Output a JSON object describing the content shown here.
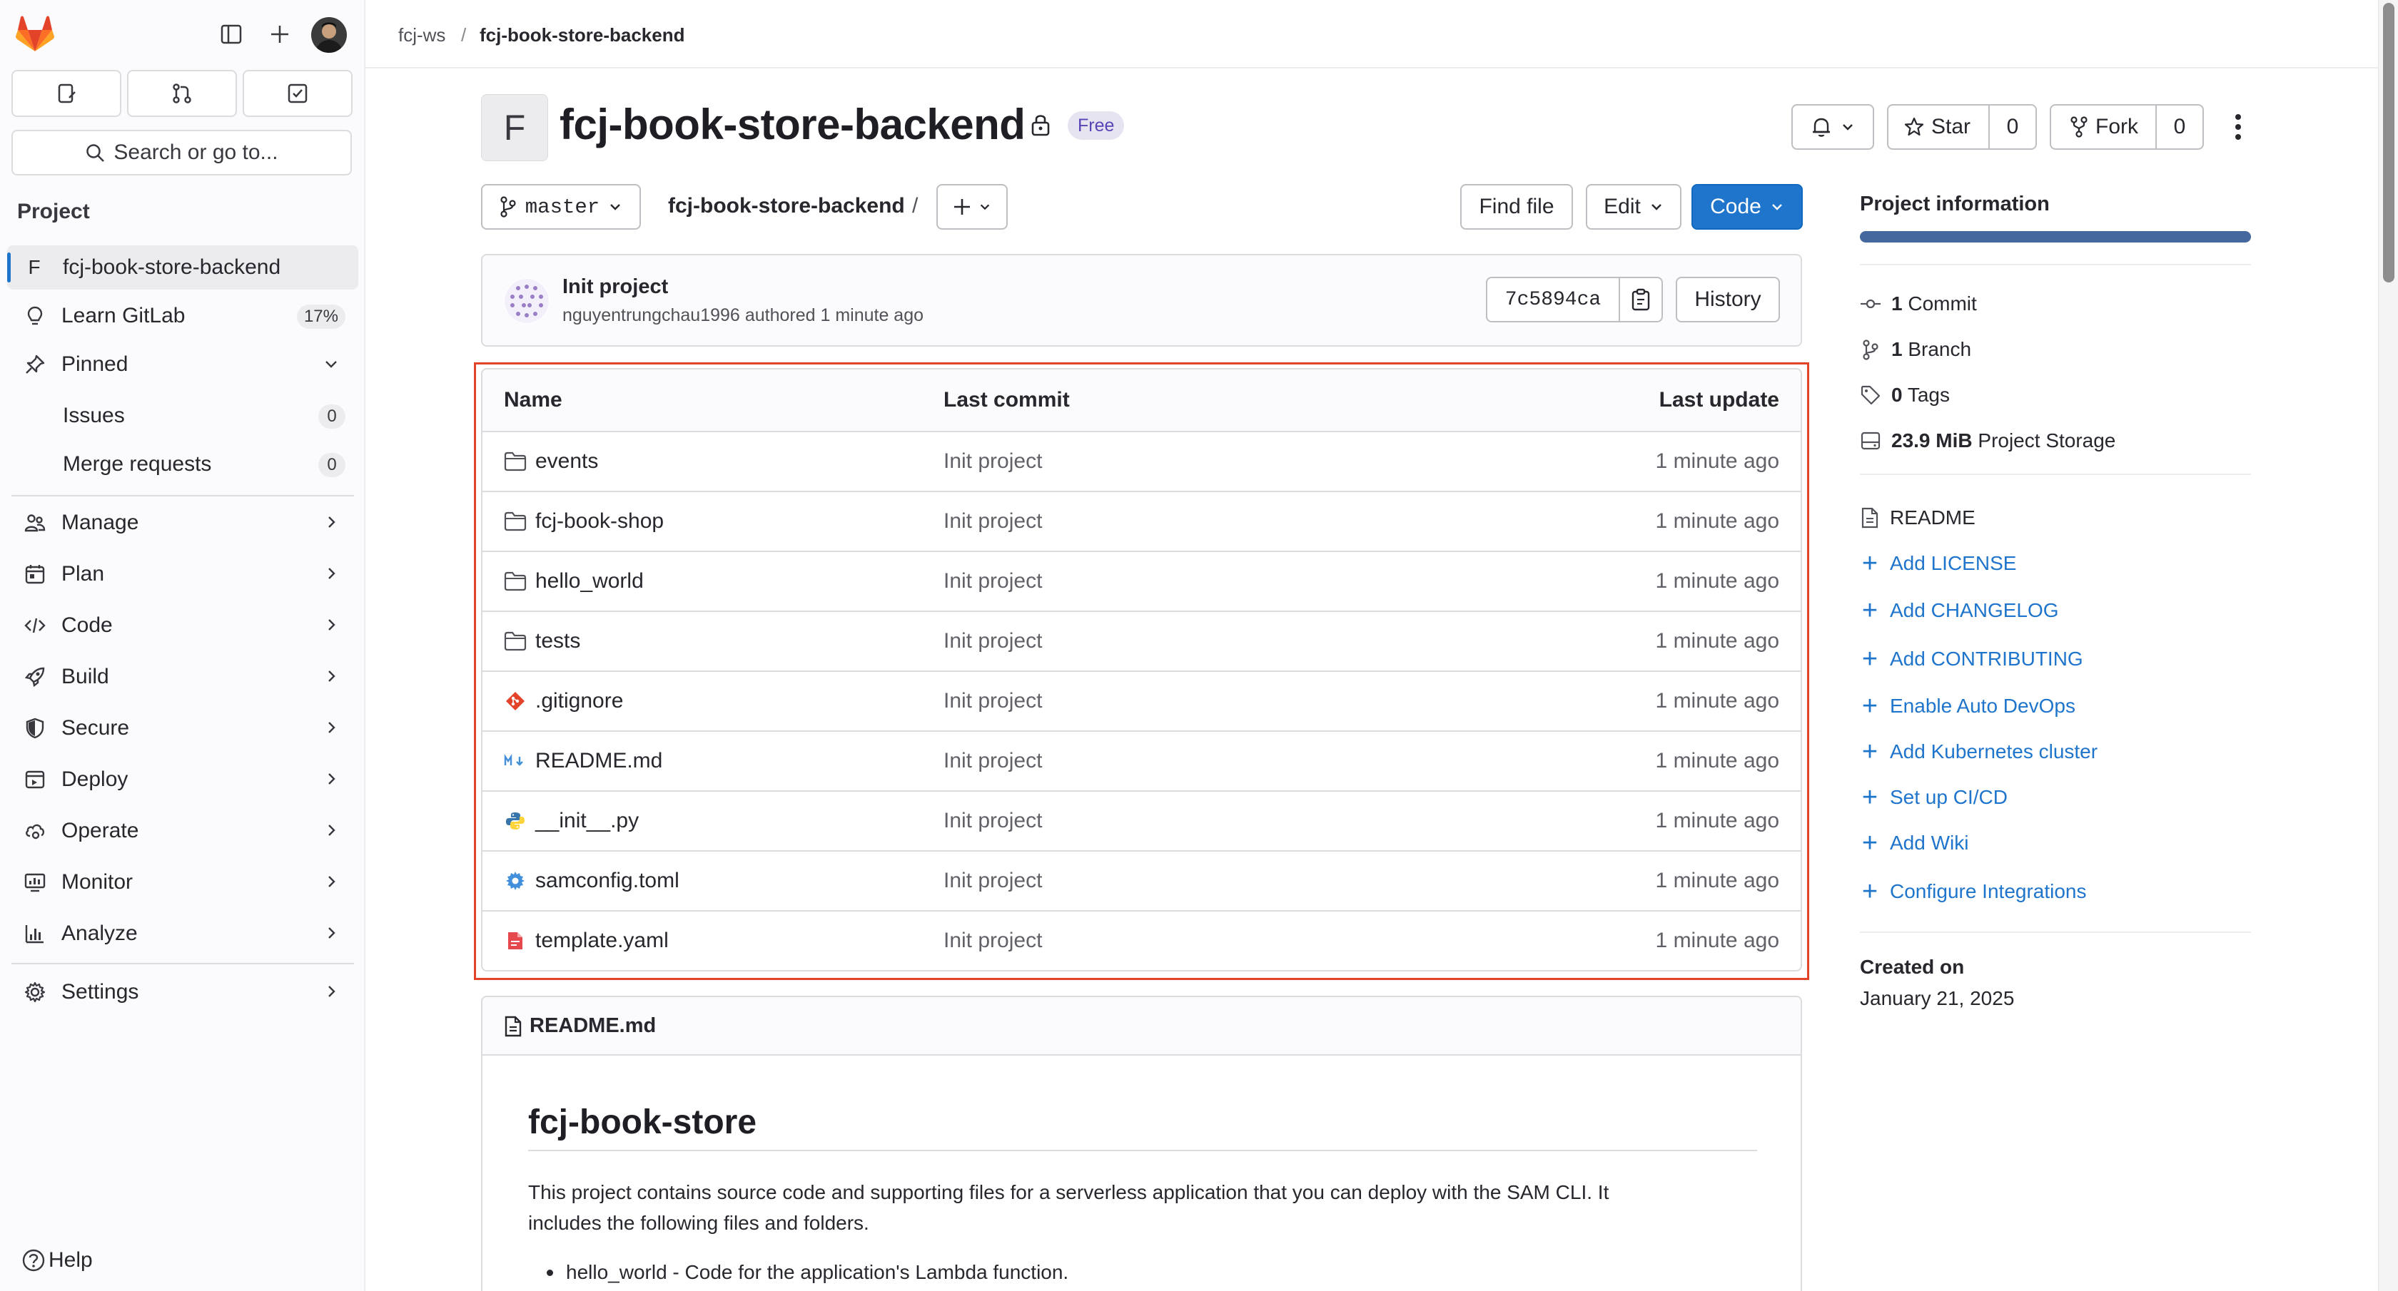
{
  "breadcrumb": {
    "group": "fcj-ws",
    "separator": "/",
    "project": "fcj-book-store-backend"
  },
  "sidebar": {
    "search_label": "Search or go to...",
    "section_title": "Project",
    "project": {
      "letter": "F",
      "name": "fcj-book-store-backend"
    },
    "learn": {
      "label": "Learn GitLab",
      "badge": "17%"
    },
    "pinned": {
      "label": "Pinned",
      "items": [
        {
          "label": "Issues",
          "count": "0"
        },
        {
          "label": "Merge requests",
          "count": "0"
        }
      ]
    },
    "items": [
      {
        "label": "Manage",
        "icon": "users-icon"
      },
      {
        "label": "Plan",
        "icon": "calendar-icon"
      },
      {
        "label": "Code",
        "icon": "code-icon"
      },
      {
        "label": "Build",
        "icon": "rocket-icon"
      },
      {
        "label": "Secure",
        "icon": "shield-icon"
      },
      {
        "label": "Deploy",
        "icon": "deploy-icon"
      },
      {
        "label": "Operate",
        "icon": "cloud-gear-icon"
      },
      {
        "label": "Monitor",
        "icon": "monitor-icon"
      },
      {
        "label": "Analyze",
        "icon": "chart-icon"
      }
    ],
    "settings": "Settings",
    "help": "Help"
  },
  "project": {
    "avatar_letter": "F",
    "title": "fcj-book-store-backend",
    "plan_badge": "Free",
    "star_label": "Star",
    "star_count": "0",
    "fork_label": "Fork",
    "fork_count": "0"
  },
  "repo_bar": {
    "branch": "master",
    "path": "fcj-book-store-backend",
    "path_sep": "/",
    "find_file": "Find file",
    "edit": "Edit",
    "code": "Code"
  },
  "last_commit": {
    "title": "Init project",
    "author": "nguyentrungchau1996",
    "authored_text": "authored 1 minute ago",
    "sha": "7c5894ca",
    "history": "History"
  },
  "files": {
    "headers": {
      "name": "Name",
      "last_commit": "Last commit",
      "last_update": "Last update"
    },
    "rows": [
      {
        "name": "events",
        "type": "folder",
        "commit": "Init project",
        "updated": "1 minute ago"
      },
      {
        "name": "fcj-book-shop",
        "type": "folder",
        "commit": "Init project",
        "updated": "1 minute ago"
      },
      {
        "name": "hello_world",
        "type": "folder",
        "commit": "Init project",
        "updated": "1 minute ago"
      },
      {
        "name": "tests",
        "type": "folder",
        "commit": "Init project",
        "updated": "1 minute ago"
      },
      {
        "name": ".gitignore",
        "type": "git",
        "commit": "Init project",
        "updated": "1 minute ago"
      },
      {
        "name": "README.md",
        "type": "markdown",
        "commit": "Init project",
        "updated": "1 minute ago"
      },
      {
        "name": "__init__.py",
        "type": "python",
        "commit": "Init project",
        "updated": "1 minute ago"
      },
      {
        "name": "samconfig.toml",
        "type": "config",
        "commit": "Init project",
        "updated": "1 minute ago"
      },
      {
        "name": "template.yaml",
        "type": "yaml",
        "commit": "Init project",
        "updated": "1 minute ago"
      }
    ]
  },
  "readme": {
    "filename": "README.md",
    "heading": "fcj-book-store",
    "paragraph_line1": "This project contains source code and supporting files for a serverless application that you can deploy with the SAM CLI. It",
    "paragraph_line2": "includes the following files and folders.",
    "bullet1": "hello_world - Code for the application's Lambda function."
  },
  "project_info": {
    "title": "Project information",
    "stats": [
      {
        "value": "1",
        "label": "Commit",
        "icon": "commit-icon"
      },
      {
        "value": "1",
        "label": "Branch",
        "icon": "branch-icon"
      },
      {
        "value": "0",
        "label": "Tags",
        "icon": "tag-icon"
      },
      {
        "value": "23.9 MiB",
        "label": "Project Storage",
        "icon": "storage-icon"
      }
    ],
    "readme": "README",
    "actions": [
      "Add LICENSE",
      "Add CHANGELOG",
      "Add CONTRIBUTING",
      "Enable Auto DevOps",
      "Add Kubernetes cluster",
      "Set up CI/CD",
      "Add Wiki",
      "Configure Integrations"
    ],
    "created_label": "Created on",
    "created_date": "January 21, 2025"
  },
  "colors": {
    "accent": "#1f75cb",
    "highlight_border": "#e24329",
    "badge_bg": "#e7e4f2",
    "badge_text": "#5943b6"
  }
}
